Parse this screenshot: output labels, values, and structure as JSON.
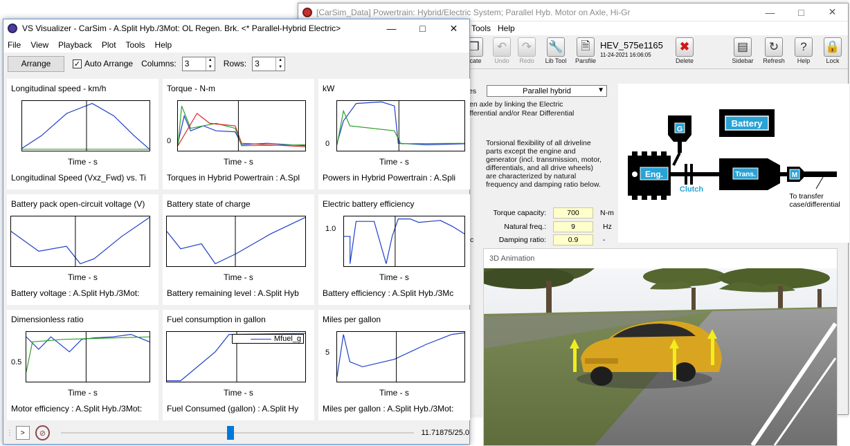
{
  "carsim": {
    "title": "[CarSim_Data] Powertrain: Hybrid/Electric System; Parallel Hyb. Motor on Axle, Hi-Gr",
    "menu": [
      "Tools",
      "Help"
    ],
    "toolbar": [
      {
        "label": "licate",
        "icon": "duplicate-icon",
        "disabled": false
      },
      {
        "label": "Undo",
        "icon": "undo-icon",
        "disabled": true
      },
      {
        "label": "Redo",
        "icon": "redo-icon",
        "disabled": true
      },
      {
        "label": "Lib Tool",
        "icon": "wrench-icon",
        "disabled": false
      },
      {
        "label": "Parsfile",
        "icon": "document-icon",
        "disabled": false
      },
      {
        "label": "Delete",
        "icon": "delete-x-icon",
        "disabled": false
      },
      {
        "label": "Sidebar",
        "icon": "sidebar-icon",
        "disabled": false
      },
      {
        "label": "Refresh",
        "icon": "refresh-icon",
        "disabled": false
      },
      {
        "label": "Help",
        "icon": "help-icon",
        "disabled": false
      },
      {
        "label": "Lock",
        "icon": "lock-icon",
        "disabled": false
      }
    ],
    "dataset_name": "HEV_575e1165",
    "dataset_date": "11-24-2021 16:06:05",
    "type_label_fragment": "es",
    "type_value": "Parallel hybrid",
    "desc_line1": "en axle by linking the Electric",
    "desc_line2": "fferential and/or Rear Differential",
    "torsion_lines": [
      "Torsional flexibility of all driveline",
      "parts except the engine and",
      "generator (incl. transmission, motor,",
      "differentials, and all drive wheels)",
      "are characterized by natural",
      "frequency and damping ratio below."
    ],
    "params": [
      {
        "label": "Torque capacity:",
        "value": "700",
        "unit": "N-m"
      },
      {
        "label": "Natural freq.:",
        "value": "9",
        "unit": "Hz"
      },
      {
        "label": "Damping ratio:",
        "value": "0.9",
        "unit": "-"
      }
    ],
    "side_fragment": "c",
    "diagram": {
      "g_label": "G",
      "battery_label": "Battery",
      "engine_label": "Eng.",
      "clutch_label": "Clutch",
      "trans_label": "Trans.",
      "motor_label": "M",
      "note_line1": "To transfer",
      "note_line2": "case/differential",
      "color_dark": "#000000",
      "color_accent": "#29a3d6"
    }
  },
  "animation": {
    "title": "3D Animation",
    "car_color": "#d9a520",
    "arrow_color": "#f2ee1c"
  },
  "visualizer": {
    "title": "VS Visualizer - CarSim - A.Split Hyb./3Mot: OL Regen. Brk. <* Parallel-Hybrid Electric>",
    "menu": [
      "File",
      "View",
      "Playback",
      "Plot",
      "Tools",
      "Help"
    ],
    "arrange_label": "Arrange",
    "auto_arrange_label": "Auto Arrange",
    "auto_arrange_checked": true,
    "columns_label": "Columns:",
    "columns_value": "3",
    "rows_label": "Rows:",
    "rows_value": "3",
    "play_label": ">",
    "time_readout": "11.71875/25.0",
    "playback_fraction": 0.47,
    "plots": [
      {
        "title": "Longitudinal speed - km/h",
        "ytick": "",
        "xlabel": "Time - s",
        "caption": "Longitudinal Speed (Vxz_Fwd) vs. Ti",
        "legend": ""
      },
      {
        "title": "Torque - N-m",
        "ytick": "0",
        "xlabel": "Time - s",
        "caption": "Torques in Hybrid Powertrain : A.Spl",
        "legend": ""
      },
      {
        "title": "kW",
        "ytick": "0",
        "xlabel": "Time - s",
        "caption": "Powers in Hybrid Powertrain : A.Spli",
        "legend": ""
      },
      {
        "title": "Battery pack open-circuit voltage (V)",
        "ytick": "",
        "xlabel": "Time - s",
        "caption": "Battery voltage : A.Split Hyb./3Mot:",
        "legend": ""
      },
      {
        "title": "Battery state of charge",
        "ytick": "",
        "xlabel": "Time - s",
        "caption": "Battery remaining level : A.Split Hyb",
        "legend": ""
      },
      {
        "title": "Electric battery efficiency",
        "ytick": "1.0",
        "xlabel": "Time - s",
        "caption": "Battery efficiency : A.Split Hyb./3Mc",
        "legend": ""
      },
      {
        "title": "Dimensionless ratio",
        "ytick": "0.5",
        "xlabel": "Time - s",
        "caption": "Motor efficiency : A.Split Hyb./3Mot:",
        "legend": ""
      },
      {
        "title": "Fuel consumption in gallon",
        "ytick": "",
        "xlabel": "Time - s",
        "caption": "Fuel Consumed (gallon) : A.Split Hy",
        "legend": "Mfuel_g"
      },
      {
        "title": "Miles per gallon",
        "ytick": "5",
        "xlabel": "Time - s",
        "caption": "Miles per gallon : A.Split Hyb./3Mot:",
        "legend": ""
      }
    ],
    "colors": {
      "primary": "#1f3fc8",
      "green": "#2ca02c",
      "red": "#d62728",
      "purple": "#9467bd",
      "cursor": "#000000"
    }
  }
}
